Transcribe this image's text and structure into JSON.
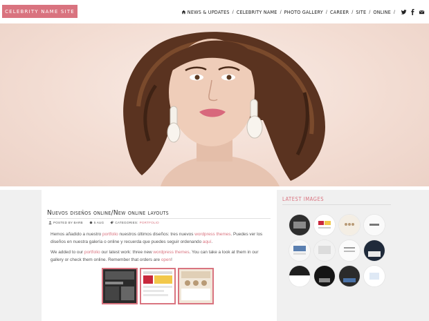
{
  "header": {
    "logo": "CELEBRITY NAME SITE",
    "nav": [
      "NEWS & UPDATES",
      "CELEBRITY NAME",
      "PHOTO GALLERY",
      "CAREER",
      "SITE",
      "ONLINE"
    ],
    "nav_icons": [
      "home-icon",
      "twitter-icon",
      "facebook-icon",
      "email-icon"
    ]
  },
  "colors": {
    "accent": "#d9737f",
    "page_bg": "#f0f0f0",
    "card_bg": "#ffffff",
    "text": "#555555"
  },
  "post": {
    "title": "Nuevos diseños online/New online layouts",
    "meta": {
      "author": "POSTED BY BARB",
      "date": "5 AUG",
      "categories_label": "CATEGORIES:",
      "category": "PORTFOLIO"
    },
    "para1": {
      "t1": "Hemos añadido a nuestro ",
      "link1": "portfolio",
      "t2": " nuestros últimos diseños: tres nuevos ",
      "link2": "wordpress themes",
      "t3": ". Puedes ver los diseños en nuestra galería o online y recuerda que puedes seguir ordenando ",
      "link3": "aquí",
      "t4": "."
    },
    "para2": {
      "t1": "We added to our ",
      "link1": "portfolio",
      "t2": " our latest work: three new ",
      "link2": "wordpress themes",
      "t3": ". You can take a look at them in our gallery or check them online. Remember that orders are ",
      "link3": "open",
      "t4": "!"
    }
  },
  "sidebar": {
    "title": "LATEST IMAGES"
  }
}
